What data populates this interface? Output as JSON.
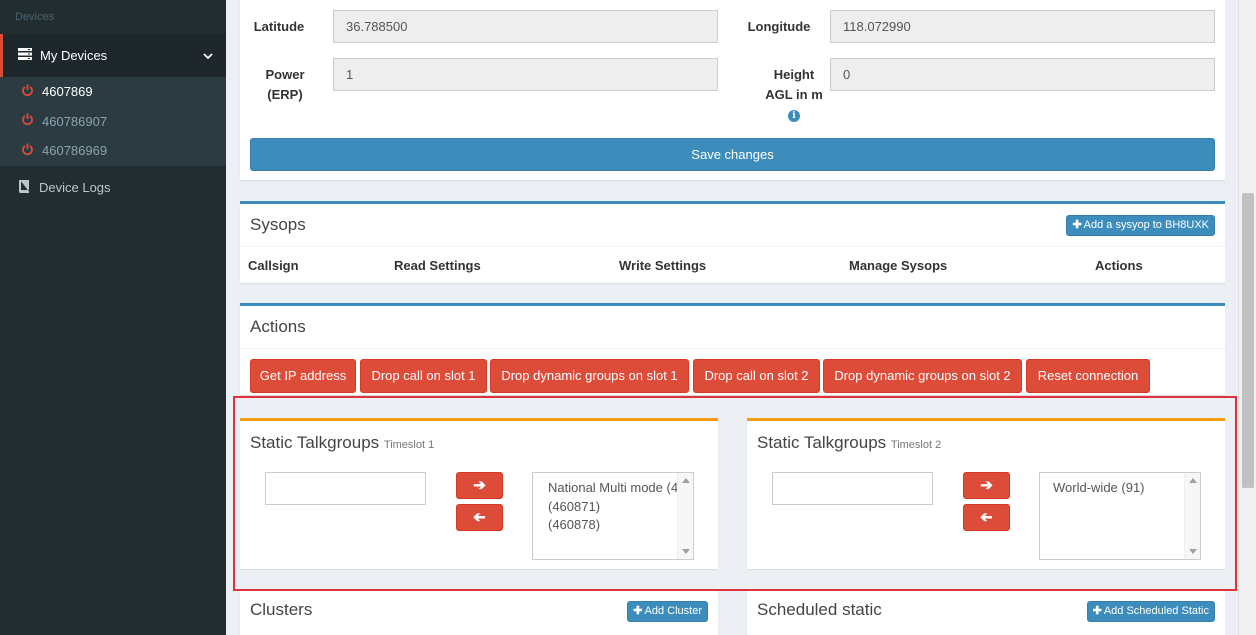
{
  "sidebar": {
    "header": "Devices",
    "my_devices_label": "My Devices",
    "devices": [
      {
        "label": "4607869",
        "active": true
      },
      {
        "label": "460786907",
        "active": false
      },
      {
        "label": "460786969",
        "active": false
      }
    ],
    "device_logs_label": "Device Logs"
  },
  "location": {
    "latitude_label": "Latitude",
    "latitude_value": "36.788500",
    "longitude_label": "Longitude",
    "longitude_value": "118.072990",
    "power_label_1": "Power",
    "power_label_2": "(ERP)",
    "power_value": "1",
    "height_label_1": "Height",
    "height_label_2": "AGL in m",
    "height_value": "0",
    "save_label": "Save changes"
  },
  "sysops": {
    "title": "Sysops",
    "add_button": "Add a sysyop to BH8UXK",
    "columns": [
      "Callsign",
      "Read Settings",
      "Write Settings",
      "Manage Sysops",
      "Actions"
    ]
  },
  "actions": {
    "title": "Actions",
    "buttons": [
      "Get IP address",
      "Drop call on slot 1",
      "Drop dynamic groups on slot 1",
      "Drop call on slot 2",
      "Drop dynamic groups on slot 2",
      "Reset connection"
    ]
  },
  "talkgroups": {
    "ts1": {
      "title": "Static Talkgroups",
      "subtitle": "Timeslot 1",
      "options": [
        "National Multi mode (4",
        "(460871)",
        "(460878)"
      ]
    },
    "ts2": {
      "title": "Static Talkgroups",
      "subtitle": "Timeslot 2",
      "options": [
        "World-wide (91)"
      ]
    }
  },
  "clusters": {
    "title": "Clusters",
    "add_button": "Add Cluster"
  },
  "scheduled": {
    "title": "Scheduled static",
    "add_button": "Add Scheduled Static"
  },
  "colors": {
    "primary": "#3c8dbc",
    "danger": "#dd4b39",
    "warning": "#f39c12",
    "sidebar": "#222d32",
    "highlight": "#e0323c"
  }
}
